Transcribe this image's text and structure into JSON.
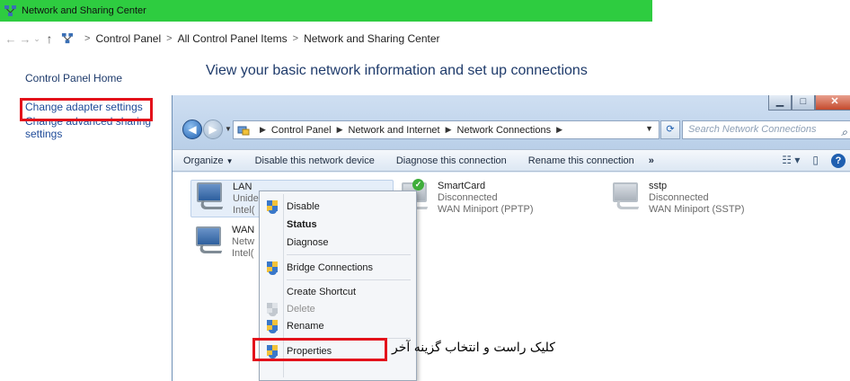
{
  "outer_window": {
    "title": "Network and Sharing Center",
    "title_color": "#2ecc40",
    "breadcrumb": [
      "Control Panel",
      "All Control Panel Items",
      "Network and Sharing Center"
    ],
    "left_nav": {
      "home": "Control Panel Home",
      "links": [
        "Change adapter settings",
        "Change advanced sharing settings"
      ]
    },
    "heading": "View your basic network information and set up connections"
  },
  "inner_window": {
    "breadcrumb": [
      "Control Panel",
      "Network and Internet",
      "Network Connections"
    ],
    "search_placeholder": "Search Network Connections",
    "toolbar": [
      "Organize",
      "Disable this network device",
      "Diagnose this connection",
      "Rename this connection"
    ],
    "toolbar_more": "»",
    "connections": [
      {
        "name": "LAN",
        "status": "Unide",
        "device": "Intel("
      },
      {
        "name": "WAN",
        "status": "Netw",
        "device": "Intel("
      },
      {
        "name": "SmartCard",
        "status": "Disconnected",
        "device": "WAN Miniport (PPTP)"
      },
      {
        "name": "sstp",
        "status": "Disconnected",
        "device": "WAN Miniport (SSTP)"
      }
    ]
  },
  "context_menu": {
    "items": [
      "Disable",
      "Status",
      "Diagnose",
      "Bridge Connections",
      "Create Shortcut",
      "Delete",
      "Rename",
      "Properties"
    ]
  },
  "annotation": "کلیک راست و انتخاب گزینه آخر",
  "highlight_color": "#e3121b"
}
